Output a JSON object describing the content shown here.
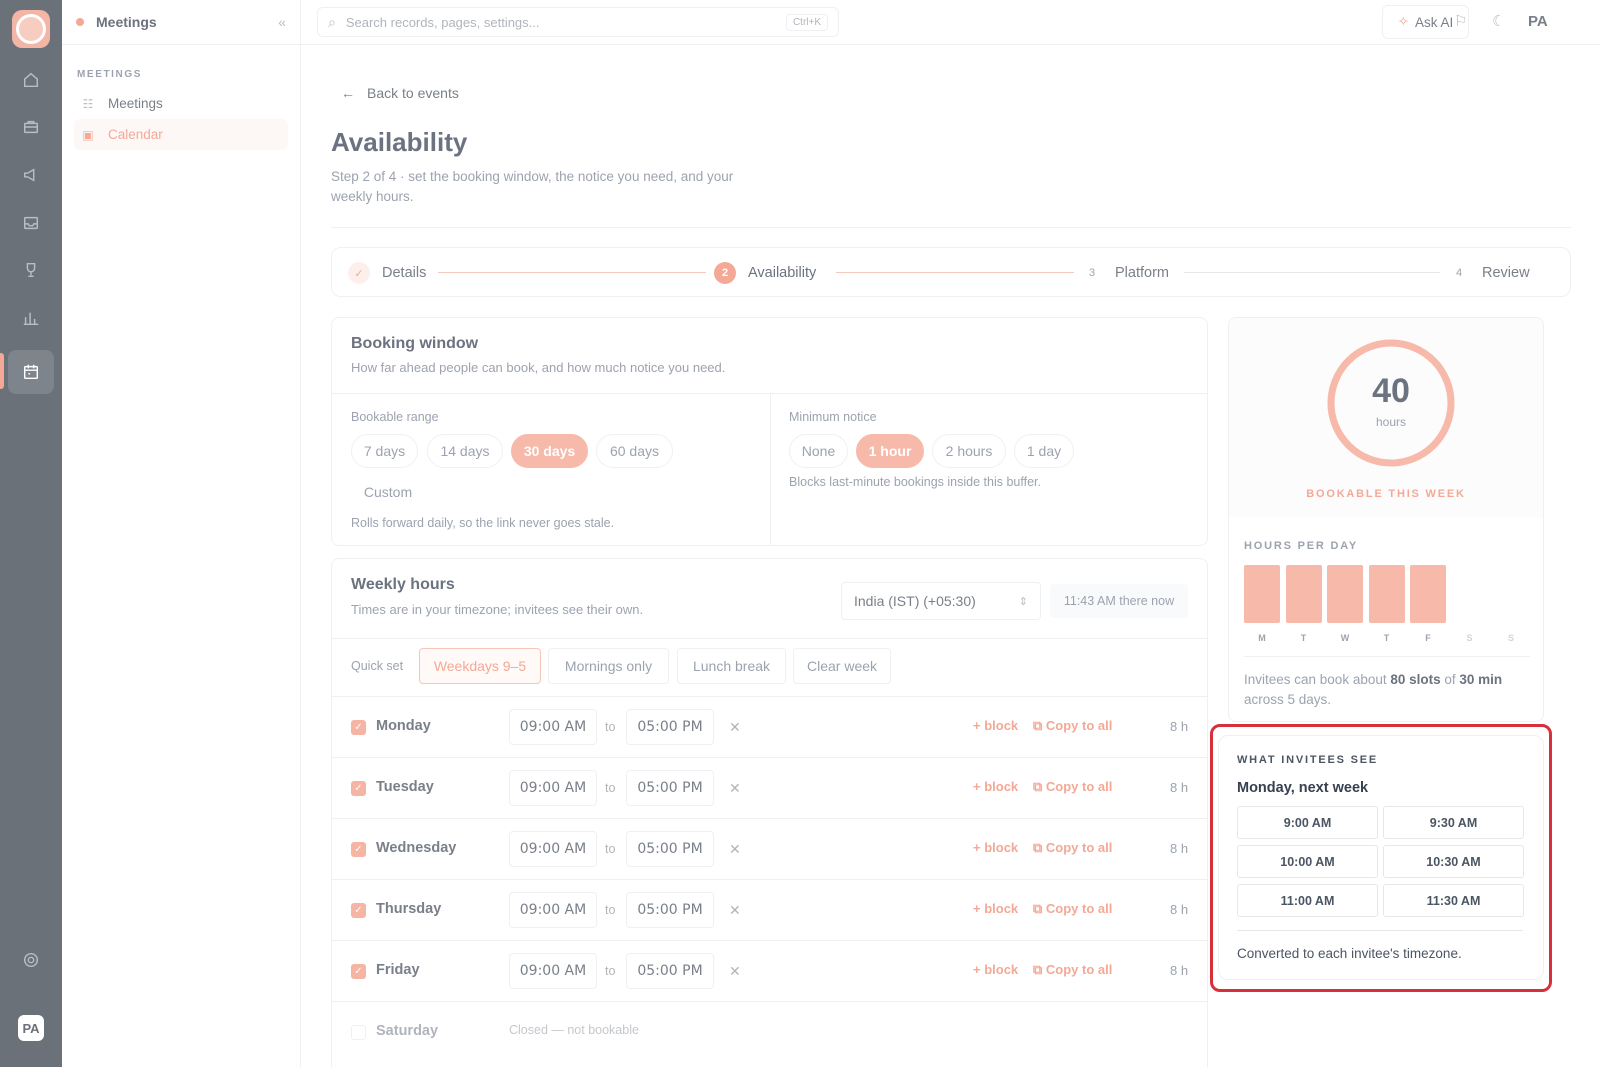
{
  "rail": {
    "icons": [
      "home-icon",
      "briefcase-icon",
      "megaphone-icon",
      "inbox-icon",
      "trophy-icon",
      "chart-icon",
      "calendar-icon"
    ],
    "active": "calendar-icon",
    "avatar": "PA"
  },
  "sidebar": {
    "title": "Meetings",
    "section": "MEETINGS",
    "items": [
      {
        "label": "Meetings",
        "icon": "list-icon",
        "active": false
      },
      {
        "label": "Calendar",
        "icon": "calendar-icon",
        "active": true
      }
    ]
  },
  "topbar": {
    "search_placeholder": "Search records, pages, settings...",
    "shortcut": "Ctrl+K",
    "ask_ai": "Ask AI",
    "avatar": "PA"
  },
  "page": {
    "back": "Back to events",
    "title": "Availability",
    "subtitle": "Step 2 of 4 · set the booking window, the notice you need, and your weekly hours."
  },
  "stepper": {
    "steps": [
      {
        "num": "✓",
        "label": "Details",
        "state": "done"
      },
      {
        "num": "2",
        "label": "Availability",
        "state": "current"
      },
      {
        "num": "3",
        "label": "Platform",
        "state": "todo"
      },
      {
        "num": "4",
        "label": "Review",
        "state": "todo"
      }
    ]
  },
  "booking": {
    "title": "Booking window",
    "subtitle": "How far ahead people can book, and how much notice you need.",
    "range_label": "Bookable range",
    "range_options": [
      "7 days",
      "14 days",
      "30 days",
      "60 days",
      "Custom"
    ],
    "range_selected": "30 days",
    "range_hint": "Rolls forward daily, so the link never goes stale.",
    "notice_label": "Minimum notice",
    "notice_options": [
      "None",
      "1 hour",
      "2 hours",
      "1 day"
    ],
    "notice_selected": "1 hour",
    "notice_hint": "Blocks last-minute bookings inside this buffer."
  },
  "weekly": {
    "title": "Weekly hours",
    "subtitle": "Times are in your timezone; invitees see their own.",
    "timezone": "India (IST) (+05:30)",
    "now": "11:43 AM there now",
    "quick_set_label": "Quick set",
    "quick_set": [
      "Weekdays 9–5",
      "Mornings only",
      "Lunch break",
      "Clear week"
    ],
    "quick_selected": "Weekdays 9–5",
    "to_label": "to",
    "add_block": "+ block",
    "copy_all": "Copy to all",
    "days": [
      {
        "name": "Monday",
        "start": "09:00 AM",
        "end": "05:00 PM",
        "hours": "8 h",
        "enabled": true
      },
      {
        "name": "Tuesday",
        "start": "09:00 AM",
        "end": "05:00 PM",
        "hours": "8 h",
        "enabled": true
      },
      {
        "name": "Wednesday",
        "start": "09:00 AM",
        "end": "05:00 PM",
        "hours": "8 h",
        "enabled": true
      },
      {
        "name": "Thursday",
        "start": "09:00 AM",
        "end": "05:00 PM",
        "hours": "8 h",
        "enabled": true
      },
      {
        "name": "Friday",
        "start": "09:00 AM",
        "end": "05:00 PM",
        "hours": "8 h",
        "enabled": true
      }
    ],
    "saturday": {
      "name": "Saturday",
      "closed": "Closed — not bookable",
      "enabled": false
    }
  },
  "summary": {
    "total": "40",
    "unit": "hours",
    "caption": "BOOKABLE THIS WEEK",
    "ring_fraction": 1.0,
    "per_day_label": "HOURS PER DAY",
    "per_day": [
      {
        "day": "M",
        "hours": 8
      },
      {
        "day": "T",
        "hours": 8
      },
      {
        "day": "W",
        "hours": 8
      },
      {
        "day": "T",
        "hours": 8
      },
      {
        "day": "F",
        "hours": 8
      },
      {
        "day": "S",
        "hours": 0
      },
      {
        "day": "S",
        "hours": 0
      }
    ],
    "blurb_pre": "Invitees can book about ",
    "blurb_slots": "80 slots",
    "blurb_mid": " of ",
    "blurb_dur": "30 min",
    "blurb_post": " across 5 days."
  },
  "invitee": {
    "title": "WHAT INVITEES SEE",
    "day": "Monday, next week",
    "slots": [
      "9:00 AM",
      "9:30 AM",
      "10:00 AM",
      "10:30 AM",
      "11:00 AM",
      "11:30 AM"
    ],
    "footer": "Converted to each invitee's timezone."
  },
  "colors": {
    "accent": "#f3a996",
    "highlight": "#d7303a",
    "rail": "#6b7178"
  }
}
